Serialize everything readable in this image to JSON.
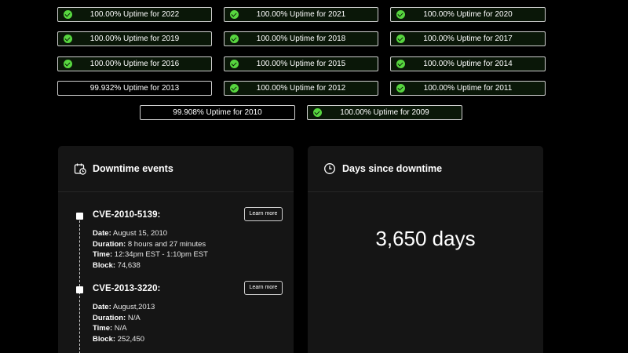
{
  "uptime_badges": [
    {
      "label": "100.00% Uptime for 2022",
      "full": true
    },
    {
      "label": "100.00% Uptime for 2021",
      "full": true
    },
    {
      "label": "100.00% Uptime for 2020",
      "full": true
    },
    {
      "label": "100.00% Uptime for 2019",
      "full": true
    },
    {
      "label": "100.00% Uptime for 2018",
      "full": true
    },
    {
      "label": "100.00% Uptime for 2017",
      "full": true
    },
    {
      "label": "100.00% Uptime for 2016",
      "full": true
    },
    {
      "label": "100.00% Uptime for 2015",
      "full": true
    },
    {
      "label": "100.00% Uptime for 2014",
      "full": true
    },
    {
      "label": "99.932% Uptime for 2013",
      "full": false
    },
    {
      "label": "100.00% Uptime for 2012",
      "full": true
    },
    {
      "label": "100.00% Uptime for 2011",
      "full": true
    },
    {
      "label": "99.908% Uptime for 2010",
      "full": false
    },
    {
      "label": "100.00% Uptime for 2009",
      "full": true
    }
  ],
  "downtime": {
    "title": "Downtime events",
    "icon": "calendar-clock-icon",
    "events": [
      {
        "title": "CVE-2010-5139:",
        "learn_more": "Learn more",
        "date_label": "Date:",
        "date": " August 15, 2010",
        "duration_label": "Duration:",
        "duration": " 8 hours and 27 minutes",
        "time_label": "Time:",
        "time": " 12:34pm EST - 1:10pm EST",
        "block_label": "Block:",
        "block": " 74,638"
      },
      {
        "title": "CVE-2013-3220:",
        "learn_more": "Learn more",
        "date_label": "Date:",
        "date": " August,2013",
        "duration_label": "Duration:",
        "duration": " N/A",
        "time_label": "Time:",
        "time": " N/A",
        "block_label": "Block:",
        "block": " 252,450"
      }
    ]
  },
  "days_since": {
    "title": "Days since downtime",
    "icon": "clock-icon",
    "value": "3,650 days"
  },
  "colors": {
    "check": "#57d63f",
    "card_bg": "#151515",
    "page_bg": "#000000"
  }
}
